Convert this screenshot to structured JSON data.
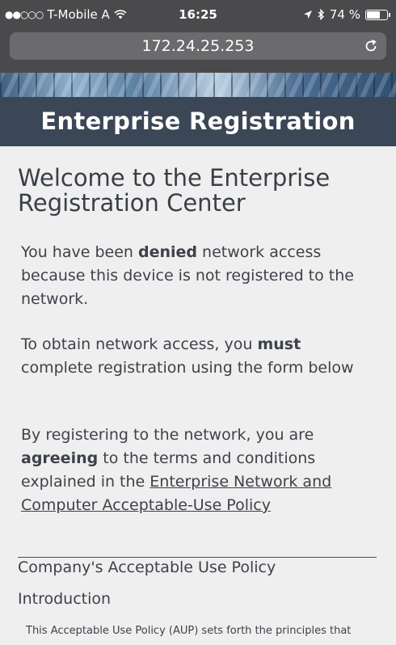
{
  "status_bar": {
    "carrier": "T-Mobile A",
    "time": "16:25",
    "battery": "74 %",
    "battery_level": 0.74,
    "signal_dots": "●●○○○"
  },
  "address_bar": {
    "url": "172.24.25.253"
  },
  "header": {
    "title": "Enterprise Registration"
  },
  "main": {
    "welcome": "Welcome to the Enterprise Registration Center",
    "p1": {
      "pre": "You have been ",
      "bold": "denied",
      "post": " network access because this device is not registered to the network."
    },
    "p2": {
      "pre": "To obtain network access, you ",
      "bold": "must",
      "post": " complete registration using the form below"
    },
    "p3": {
      "pre": "By registering to the network, you are ",
      "bold": "agreeing",
      "mid": " to the terms and conditions explained in the ",
      "link": "Enterprise Network and Computer Acceptable-Use Policy"
    },
    "aup_heading": "Company's Acceptable Use Policy",
    "intro_heading": "Introduction",
    "aup_body": "This Acceptable Use Policy (AUP) sets forth the principles that"
  }
}
